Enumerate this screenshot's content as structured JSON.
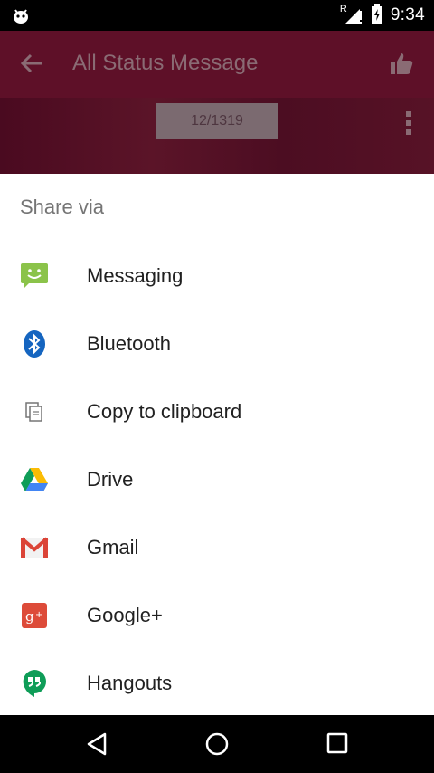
{
  "status_bar": {
    "time": "9:34",
    "signal_label": "R",
    "icons": [
      "android-debug-icon",
      "signal-roaming-icon",
      "battery-charging-icon"
    ]
  },
  "app_bar": {
    "title": "All Status Message",
    "icons": [
      "back-arrow-icon",
      "thumbs-up-icon"
    ]
  },
  "behind": {
    "counter": "12/1319"
  },
  "share_sheet": {
    "header": "Share via",
    "items": [
      {
        "label": "Messaging",
        "icon": "messaging-icon"
      },
      {
        "label": "Bluetooth",
        "icon": "bluetooth-icon"
      },
      {
        "label": "Copy to clipboard",
        "icon": "clipboard-icon"
      },
      {
        "label": "Drive",
        "icon": "drive-icon"
      },
      {
        "label": "Gmail",
        "icon": "gmail-icon"
      },
      {
        "label": "Google+",
        "icon": "google-plus-icon"
      },
      {
        "label": "Hangouts",
        "icon": "hangouts-icon"
      }
    ]
  },
  "nav_bar": {
    "icons": [
      "back-triangle-icon",
      "home-circle-icon",
      "recents-square-icon"
    ]
  },
  "colors": {
    "app_bar_dimmed": "#5e1028",
    "messaging_green": "#8bc34a",
    "bluetooth_blue": "#1565c0",
    "gmail_red": "#db4437",
    "google_plus_red": "#dd4b39",
    "hangouts_green": "#0f9d58"
  }
}
